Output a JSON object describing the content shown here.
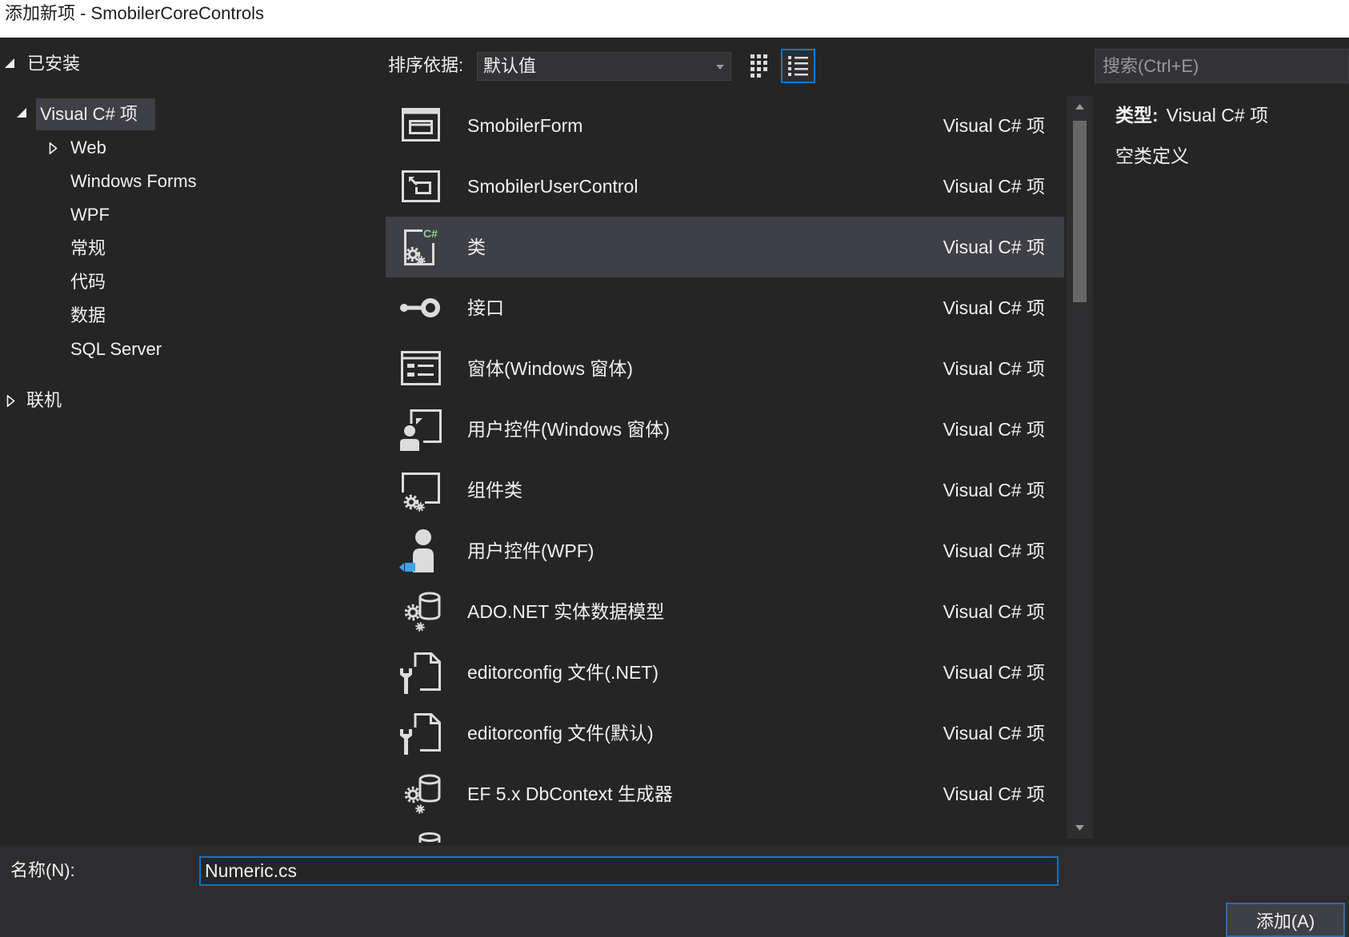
{
  "window": {
    "title": "添加新项 - SmobilerCoreControls"
  },
  "colors": {
    "title_bar": "#ffffff",
    "background": "#252526",
    "panel": "#2d2d30",
    "text": "#f1f1f1",
    "selection": "#3f3f46",
    "accent": "#007acc",
    "control": "#333337",
    "icon": "#dcdcdc",
    "badge_green": "#8fd18f",
    "wpf_blue": "#3ca3e6"
  },
  "tree": {
    "installed": {
      "label": "已安装",
      "expanded": true,
      "visual_csharp": {
        "label": "Visual C# 项",
        "expanded": true,
        "selected": true,
        "children": [
          {
            "label": "Web",
            "expandable": true,
            "expanded": false
          },
          {
            "label": "Windows Forms"
          },
          {
            "label": "WPF"
          },
          {
            "label": "常规"
          },
          {
            "label": "代码"
          },
          {
            "label": "数据"
          },
          {
            "label": "SQL Server"
          }
        ]
      }
    },
    "online": {
      "label": "联机",
      "expandable": true,
      "expanded": false
    }
  },
  "toolbar": {
    "sort_label": "排序依据:",
    "sort_value": "默认值",
    "view_mode": "list"
  },
  "search": {
    "placeholder": "搜索(Ctrl+E)"
  },
  "list": {
    "items": [
      {
        "name": "SmobilerForm",
        "type": "Visual C# 项",
        "icon": "form-window-icon"
      },
      {
        "name": "SmobilerUserControl",
        "type": "Visual C# 项",
        "icon": "user-control-icon"
      },
      {
        "name": "类",
        "type": "Visual C# 项",
        "icon": "class-icon",
        "badge": "C#",
        "selected": true
      },
      {
        "name": "接口",
        "type": "Visual C# 项",
        "icon": "interface-icon"
      },
      {
        "name": "窗体(Windows 窗体)",
        "type": "Visual C# 项",
        "icon": "windows-form-icon"
      },
      {
        "name": "用户控件(Windows 窗体)",
        "type": "Visual C# 项",
        "icon": "winforms-user-control-icon"
      },
      {
        "name": "组件类",
        "type": "Visual C# 项",
        "icon": "component-class-icon"
      },
      {
        "name": "用户控件(WPF)",
        "type": "Visual C# 项",
        "icon": "wpf-user-control-icon"
      },
      {
        "name": "ADO.NET 实体数据模型",
        "type": "Visual C# 项",
        "icon": "entity-data-model-icon"
      },
      {
        "name": "editorconfig 文件(.NET)",
        "type": "Visual C# 项",
        "icon": "editorconfig-icon"
      },
      {
        "name": "editorconfig 文件(默认)",
        "type": "Visual C# 项",
        "icon": "editorconfig-icon"
      },
      {
        "name": "EF 5.x DbContext 生成器",
        "type": "Visual C# 项",
        "icon": "dbcontext-generator-icon"
      }
    ]
  },
  "details": {
    "type_label": "类型:",
    "type_value": "Visual C# 项",
    "description": "空类定义"
  },
  "name_field": {
    "label": "名称(N):",
    "value": "Numeric.cs"
  },
  "actions": {
    "add_label": "添加(A)"
  }
}
